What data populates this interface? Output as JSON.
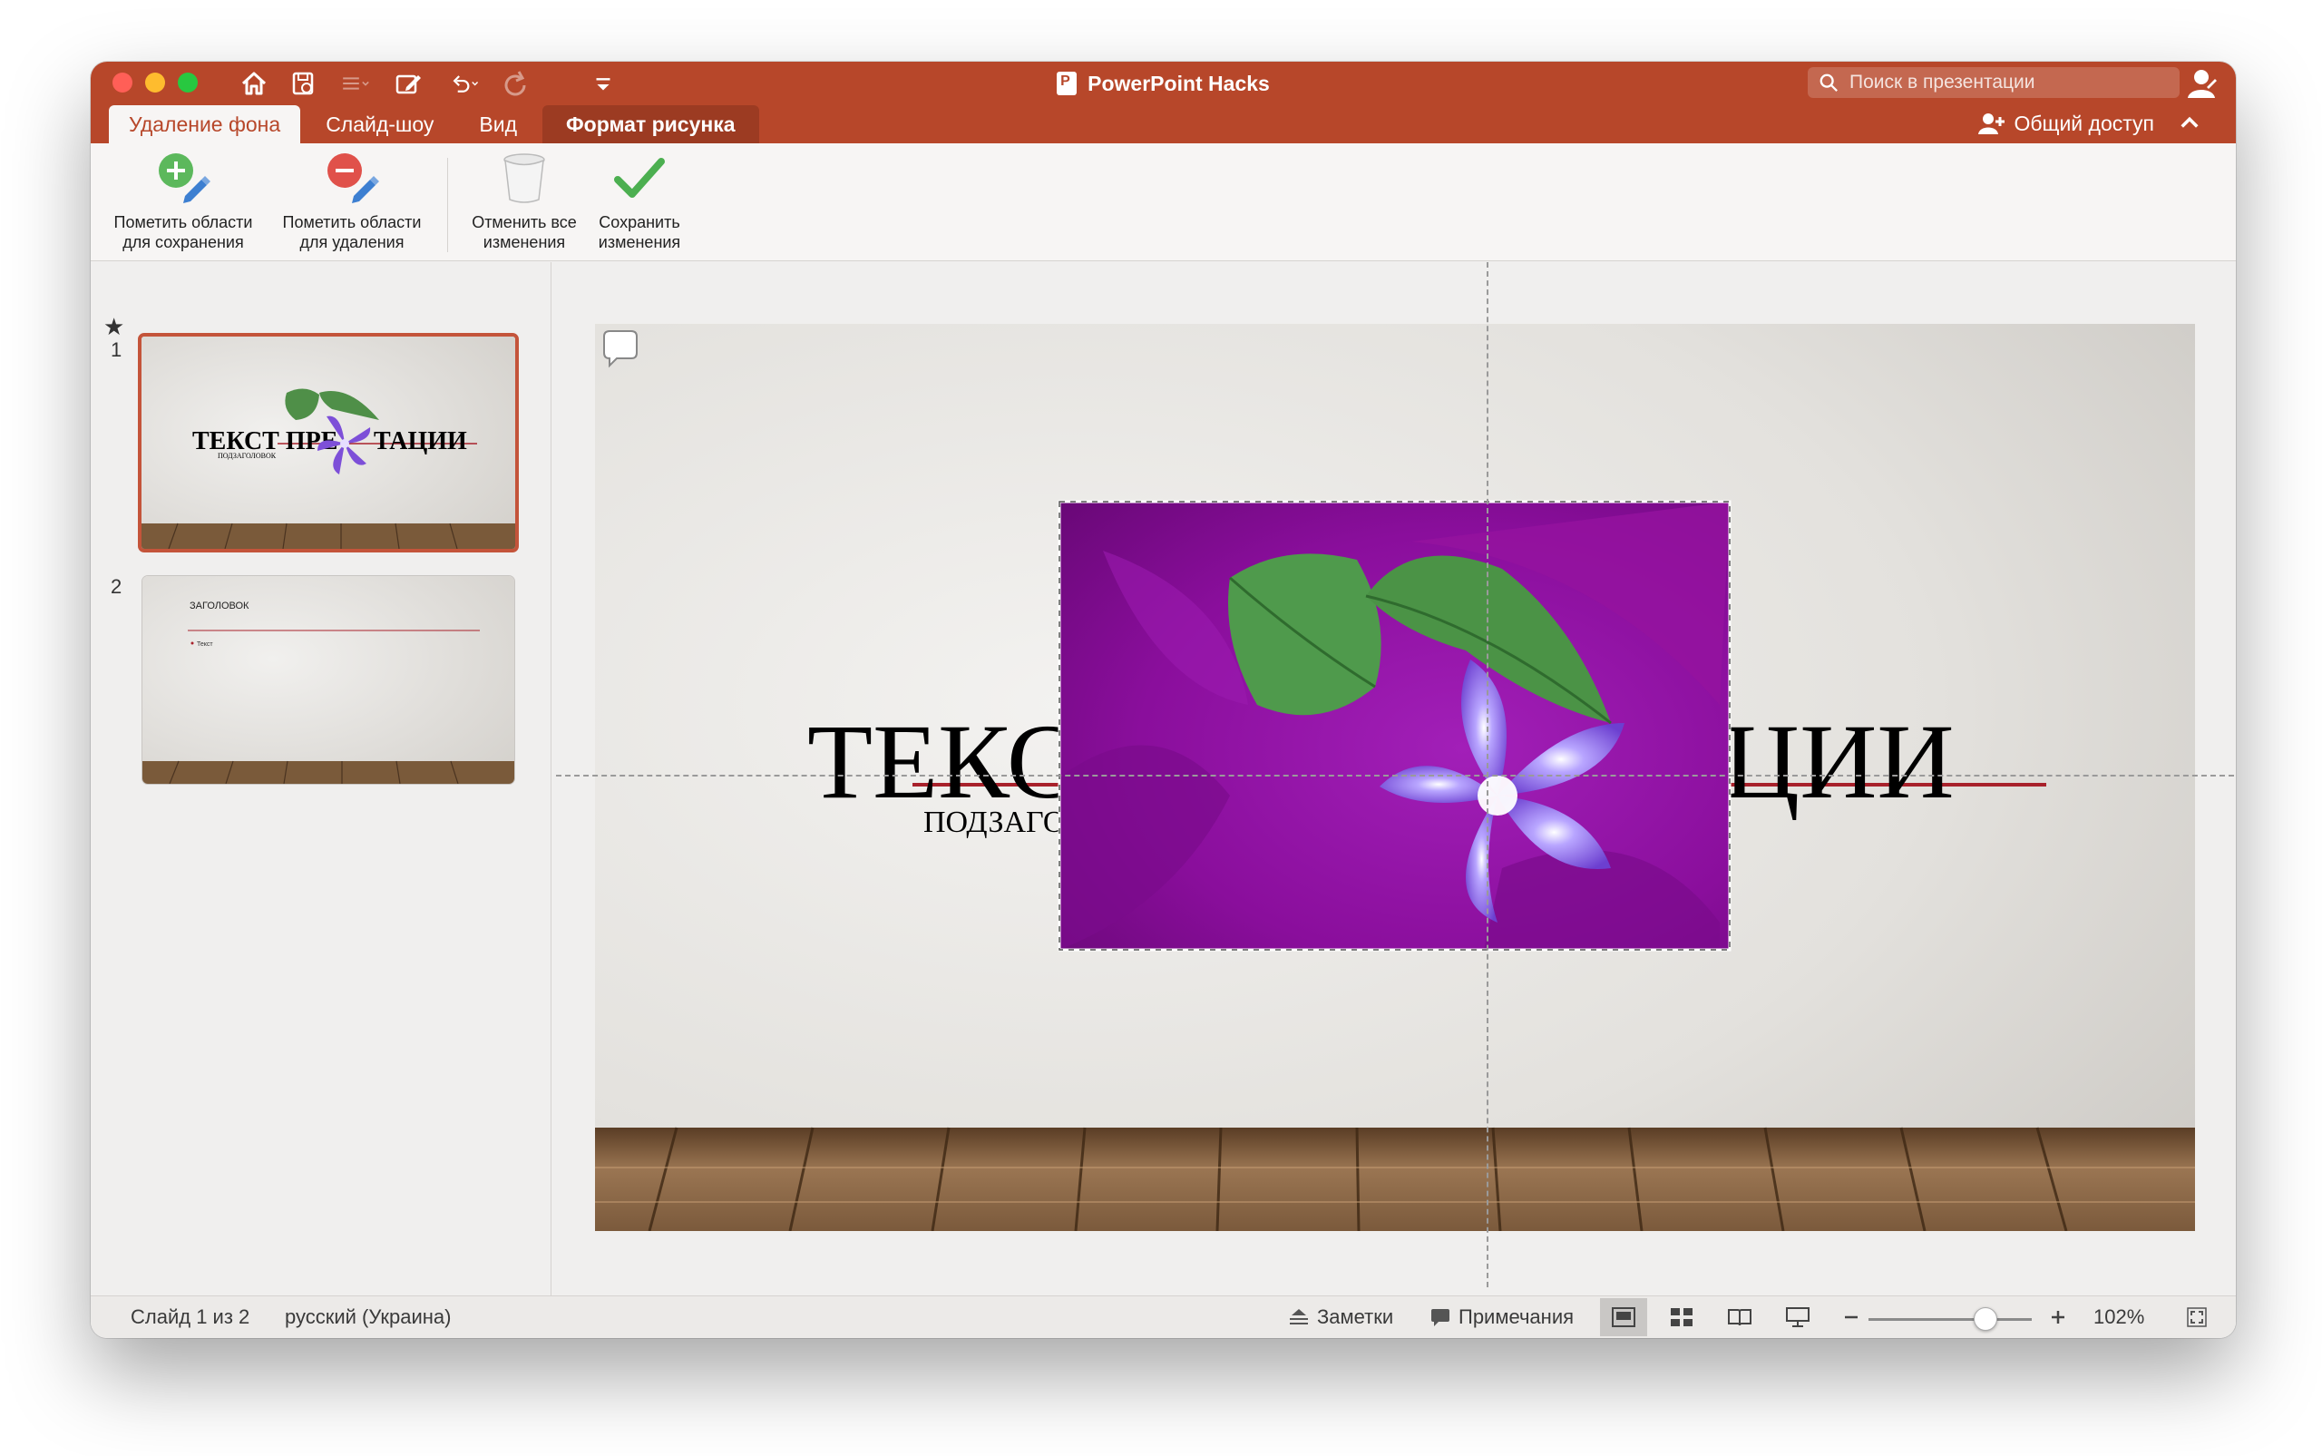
{
  "window": {
    "title": "PowerPoint Hacks",
    "search_placeholder": "Поиск в презентации"
  },
  "tabs": [
    {
      "label": "Удаление фона"
    },
    {
      "label": "Слайд-шоу"
    },
    {
      "label": "Вид"
    },
    {
      "label": "Формат рисунка"
    }
  ],
  "share": {
    "label": "Общий доступ"
  },
  "ribbon": {
    "mark_keep": "Пометить области\nдля сохранения",
    "mark_remove": "Пометить области\nдля удаления",
    "discard_all": "Отменить все\nизменения",
    "keep_changes": "Сохранить\nизменения"
  },
  "thumbnails": [
    {
      "number": "1",
      "title": "ТЕКСТ ПРЕ",
      "title_end": "ТАЦИИ",
      "subtitle": "ПОДЗАГОЛОВОК"
    },
    {
      "number": "2",
      "title": "ЗАГОЛОВОК",
      "bullet": "Текст"
    }
  ],
  "slide": {
    "title_left": "ТЕКС",
    "title_right": "ЦИИ",
    "subtitle": "ПОДЗАГО"
  },
  "status": {
    "slide_counter": "Слайд 1 из 2",
    "language": "русский (Украина)",
    "notes": "Заметки",
    "comments": "Примечания",
    "zoom": "102%",
    "zoom_level_percent": 102
  },
  "colors": {
    "accent": "#b7472a",
    "accent_dark": "#9c3b22",
    "removal_overlay": "#9a12a8",
    "title_underline": "#a8212b"
  },
  "icons": {
    "home": "home-icon",
    "save": "save-icon",
    "undo": "undo-icon",
    "redo": "redo-icon",
    "search": "search-icon",
    "share": "add-person-icon"
  }
}
